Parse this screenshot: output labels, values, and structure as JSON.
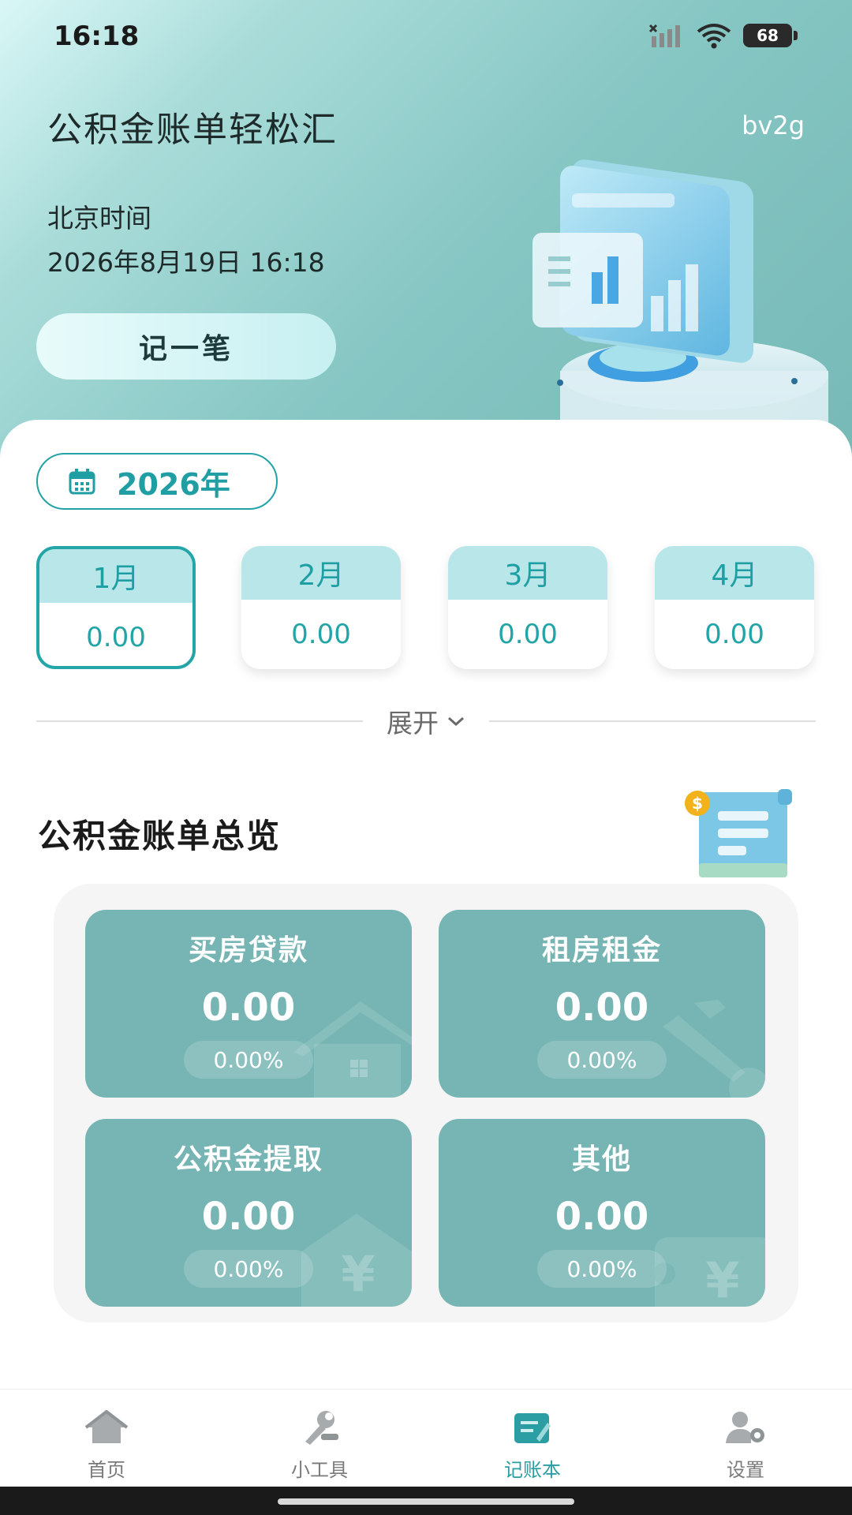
{
  "status_bar": {
    "time": "16:18",
    "battery": "68"
  },
  "header": {
    "title": "公积金账单轻松汇",
    "user": "bv2g",
    "time_label": "北京时间",
    "datetime": "2026年8月19日 16:18",
    "record_button": "记一笔"
  },
  "year_picker": {
    "label": "2026年"
  },
  "months": [
    {
      "label": "1月",
      "value": "0.00",
      "selected": true
    },
    {
      "label": "2月",
      "value": "0.00",
      "selected": false
    },
    {
      "label": "3月",
      "value": "0.00",
      "selected": false
    },
    {
      "label": "4月",
      "value": "0.00",
      "selected": false
    }
  ],
  "expand": {
    "label": "展开"
  },
  "overview": {
    "title": "公积金账单总览",
    "cards": [
      {
        "label": "买房贷款",
        "value": "0.00",
        "percent": "0.00%",
        "icon": "house-icon"
      },
      {
        "label": "租房租金",
        "value": "0.00",
        "percent": "0.00%",
        "icon": "key-icon"
      },
      {
        "label": "公积金提取",
        "value": "0.00",
        "percent": "0.00%",
        "icon": "house-yen-icon"
      },
      {
        "label": "其他",
        "value": "0.00",
        "percent": "0.00%",
        "icon": "wallet-yen-icon"
      }
    ]
  },
  "nav": {
    "items": [
      {
        "label": "首页",
        "icon": "home-icon",
        "active": false
      },
      {
        "label": "小工具",
        "icon": "tools-icon",
        "active": false
      },
      {
        "label": "记账本",
        "icon": "ledger-icon",
        "active": true
      },
      {
        "label": "设置",
        "icon": "user-settings-icon",
        "active": false
      }
    ]
  },
  "colors": {
    "accent": "#23a2a6",
    "card": "#76b5b3",
    "month_head": "#b9e6e8"
  }
}
